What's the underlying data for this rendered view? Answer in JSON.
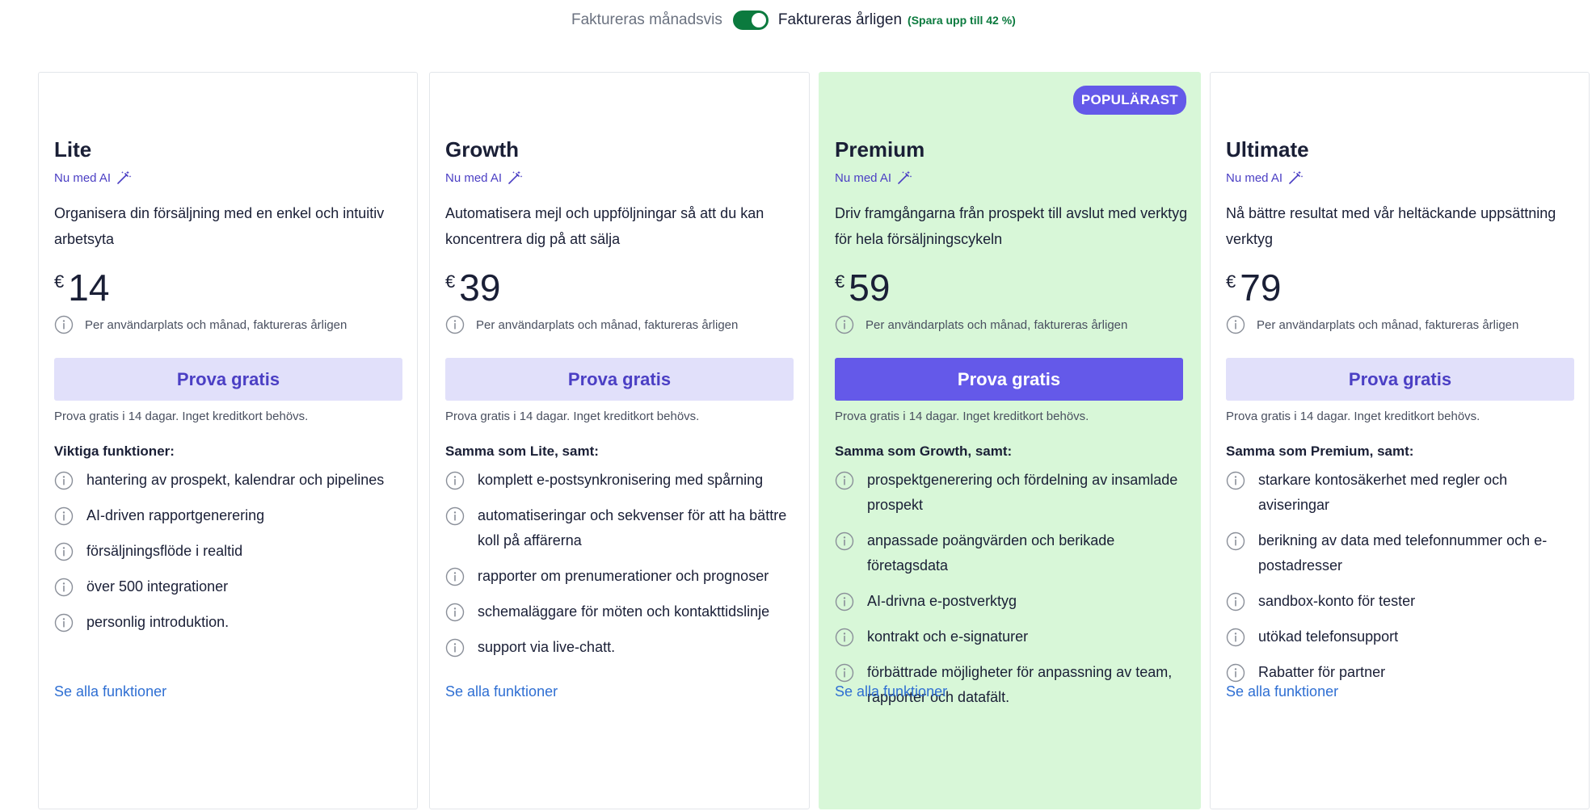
{
  "billing": {
    "monthly_label": "Faktureras månadsvis",
    "yearly_label": "Faktureras årligen",
    "save_note": "(Spara upp till 42 %)",
    "selected": "yearly",
    "accent": "#0b7a3e"
  },
  "common": {
    "ai_label": "Nu med AI",
    "currency": "€",
    "per_note": "Per användarplats och månad, faktureras årligen",
    "cta_label": "Prova gratis",
    "trial_note": "Prova gratis i 14 dagar. Inget kreditkort behövs.",
    "see_all": "Se alla funktioner"
  },
  "plans": [
    {
      "name": "Lite",
      "description": "Organisera din försäljning med en enkel och intuitiv arbetsyta",
      "price": "14",
      "features_heading": "Viktiga funktioner:",
      "features": [
        "hantering av prospekt, kalendrar och pipelines",
        "AI-driven rapportgenerering",
        "försäljningsflöde i realtid",
        "över 500 integrationer",
        "personlig introduktion."
      ]
    },
    {
      "name": "Growth",
      "description": "Automatisera mejl och uppföljningar så att du kan koncentrera dig på att sälja",
      "price": "39",
      "features_heading": "Samma som Lite, samt:",
      "features": [
        "komplett e-postsynkronisering med spårning",
        "automatiseringar och sekvenser för att ha bättre koll på affärerna",
        "rapporter om prenumerationer och prognoser",
        "schemaläggare för möten och kontakttidslinje",
        "support via live-chatt."
      ]
    },
    {
      "name": "Premium",
      "badge": "POPULÄRAST",
      "description": "Driv framgångarna från prospekt till avslut med verktyg för hela försäljningscykeln",
      "price": "59",
      "features_heading": "Samma som Growth, samt:",
      "features": [
        "prospektgenerering och fördelning av insamlade prospekt",
        "anpassade poängvärden och berikade företagsdata",
        "AI-drivna e-postverktyg",
        "kontrakt och e-signaturer",
        "förbättrade möjligheter för anpassning av team, rapporter och datafält."
      ]
    },
    {
      "name": "Ultimate",
      "description": "Nå bättre resultat med vår heltäckande uppsättning verktyg",
      "price": "79",
      "features_heading": "Samma som Premium, samt:",
      "features": [
        "starkare kontosäkerhet med regler och aviseringar",
        "berikning av data med telefonnummer och e-postadresser",
        "sandbox-konto för tester",
        "utökad telefonsupport",
        "Rabatter för partner"
      ]
    }
  ],
  "colors": {
    "brand": "#6459e9",
    "cta_light": "#e1e0fa",
    "featured_bg": "#d8f7d8",
    "link": "#2f6fd3"
  },
  "icons": {
    "info": "info-circle-icon",
    "ai": "magic-wand-icon",
    "toggle": "toggle-switch"
  }
}
